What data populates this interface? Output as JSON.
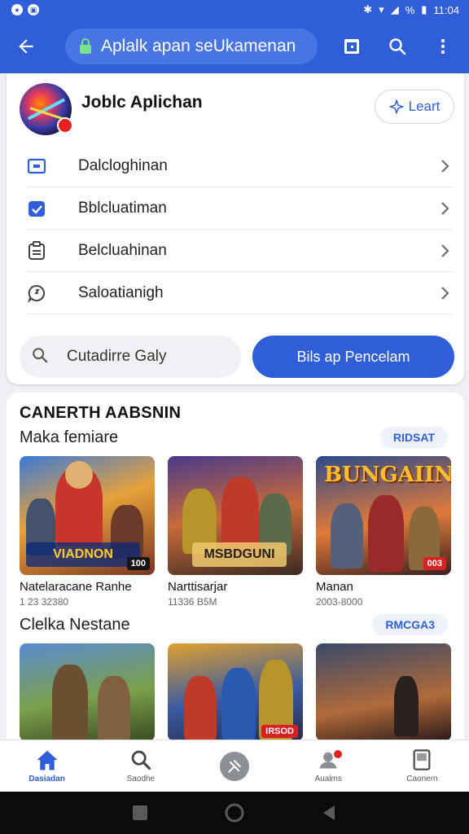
{
  "status_bar": {
    "time": "11:04",
    "battery": "%"
  },
  "app_bar": {
    "url_text": "Aplalk apan seUkamenan"
  },
  "app_header": {
    "title": "Joblc Aplichan",
    "learn_label": "Leart"
  },
  "menu": [
    {
      "label": "Dalcloghinan",
      "icon": "window-icon"
    },
    {
      "label": "Bblcluatiman",
      "icon": "check-calendar-icon"
    },
    {
      "label": "Belcluahinan",
      "icon": "clipboard-icon"
    },
    {
      "label": "Saloatianigh",
      "icon": "chat-icon"
    }
  ],
  "gallery": {
    "value": "Cutadirre Galy"
  },
  "primary_button": {
    "label": "Bils ap Pencelam"
  },
  "section": {
    "heading": "CANERTH AABSNIN",
    "row1": {
      "title": "Maka femiare",
      "button": "RIDSAT",
      "games": [
        {
          "name": "Natelaracane Ranhe",
          "meta": "1 23 32380",
          "banner": "VIADNON",
          "badge": "100"
        },
        {
          "name": "Narttisarjar",
          "meta": "11336 B5M",
          "banner": "MSBDGUNI",
          "badge": ""
        },
        {
          "name": "Manan",
          "meta": "2003-8000",
          "logo": "BUNGAIIN",
          "badge": "003"
        }
      ]
    },
    "row2": {
      "title": "Clelka Nestane",
      "button": "RMCGA3",
      "tiles": [
        {
          "badge": ""
        },
        {
          "badge": "IRSOD"
        },
        {
          "badge": ""
        }
      ]
    }
  },
  "bottom_nav": [
    {
      "label": "Dasiadan",
      "icon": "home-icon",
      "active": true
    },
    {
      "label": "Saodhe",
      "icon": "search-icon",
      "active": false
    },
    {
      "label": "",
      "icon": "settings-center-icon",
      "active": false
    },
    {
      "label": "Aualms",
      "icon": "notifications-icon",
      "active": false
    },
    {
      "label": "Caonern",
      "icon": "library-icon",
      "active": false
    }
  ],
  "colors": {
    "primary": "#2f5ed8",
    "badge_red": "#e52222"
  }
}
